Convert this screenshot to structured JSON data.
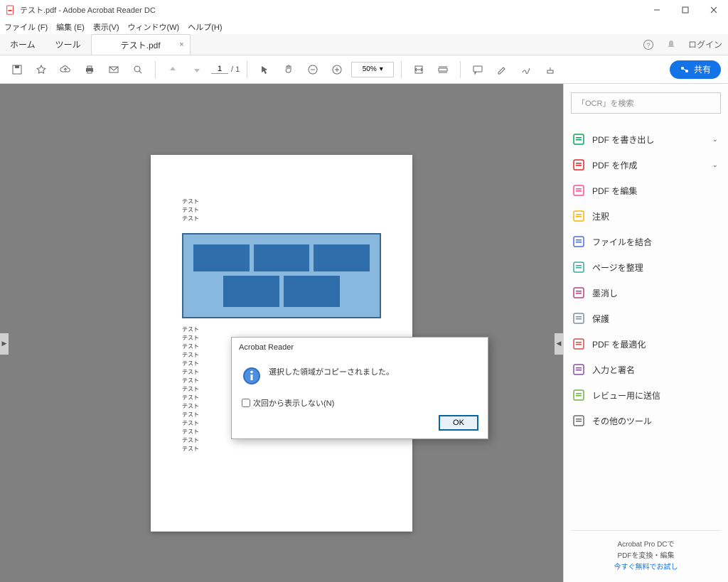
{
  "titlebar": {
    "title": "テスト.pdf - Adobe Acrobat Reader DC"
  },
  "menubar": [
    "ファイル (F)",
    "編集 (E)",
    "表示(V)",
    "ウィンドウ(W)",
    "ヘルプ(H)"
  ],
  "tabrow": {
    "home": "ホーム",
    "tool": "ツール",
    "tab": "テスト.pdf",
    "login": "ログイン"
  },
  "toolbar": {
    "page_current": "1",
    "page_total": "/ 1",
    "zoom": "50%",
    "share": "共有"
  },
  "page": {
    "repeat_text": "テスト",
    "top_count": 3,
    "bottom_count": 15
  },
  "dialog": {
    "title": "Acrobat Reader",
    "message": "選択した領域がコピーされました。",
    "checkbox": "次回から表示しない(N)",
    "ok": "OK"
  },
  "rpanel": {
    "search_placeholder": "「OCR」を検索",
    "tools": [
      {
        "label": "PDF を書き出し",
        "color": "#0aa35a",
        "hasChevron": true
      },
      {
        "label": "PDF を作成",
        "color": "#ed2224",
        "hasChevron": true
      },
      {
        "label": "PDF を編集",
        "color": "#ff4d8d"
      },
      {
        "label": "注釈",
        "color": "#f5b400"
      },
      {
        "label": "ファイルを結合",
        "color": "#4d6bdb"
      },
      {
        "label": "ページを整理",
        "color": "#3aa6a0"
      },
      {
        "label": "墨消し",
        "color": "#b0437a"
      },
      {
        "label": "保護",
        "color": "#7a8fa6"
      },
      {
        "label": "PDF を最適化",
        "color": "#d64c4c"
      },
      {
        "label": "入力と署名",
        "color": "#8a4ea3"
      },
      {
        "label": "レビュー用に送信",
        "color": "#6fb43f"
      },
      {
        "label": "その他のツール",
        "color": "#6b6b6b"
      }
    ],
    "promo1": "Acrobat Pro DCで",
    "promo2": "PDFを変換・編集",
    "promo_link": "今すぐ無料でお試し"
  }
}
